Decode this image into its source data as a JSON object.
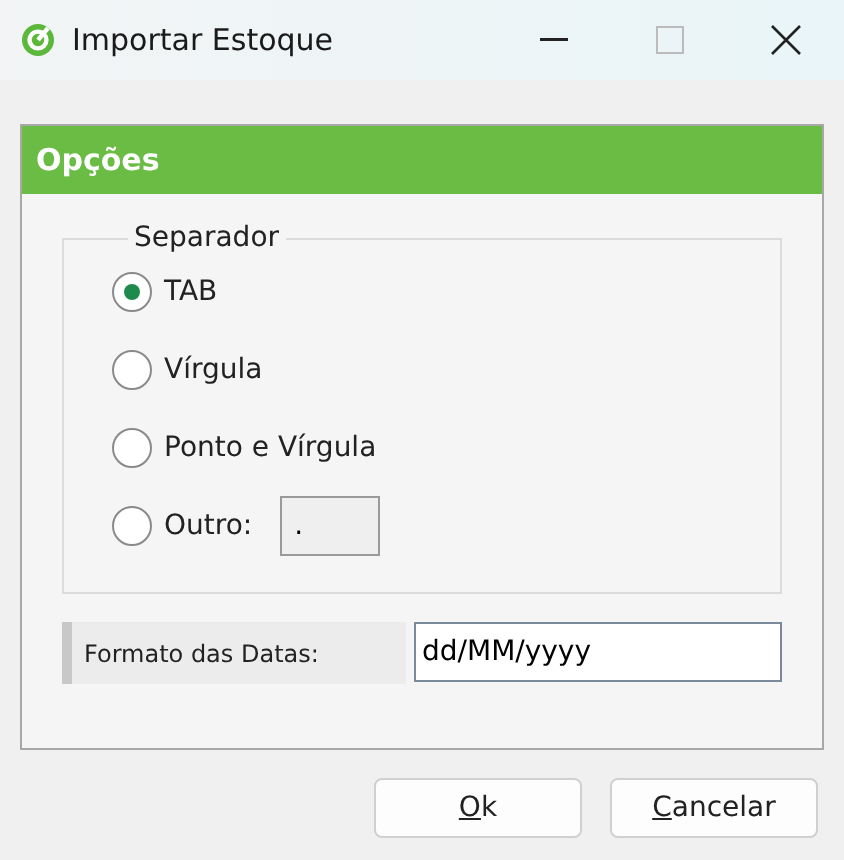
{
  "window": {
    "title": "Importar Estoque"
  },
  "panel": {
    "title": "Opções"
  },
  "separator_group": {
    "title": "Separador",
    "options": [
      {
        "label": "TAB",
        "selected": true
      },
      {
        "label": "Vírgula",
        "selected": false
      },
      {
        "label": "Ponto e Vírgula",
        "selected": false
      },
      {
        "label": "Outro:",
        "selected": false,
        "field_value": "."
      }
    ]
  },
  "date_format": {
    "label": "Formato das Datas:",
    "value": "dd/MM/yyyy"
  },
  "buttons": [
    {
      "label": "Ok",
      "underline_first": true
    },
    {
      "label": "Cancelar",
      "underline_first": true
    }
  ]
}
